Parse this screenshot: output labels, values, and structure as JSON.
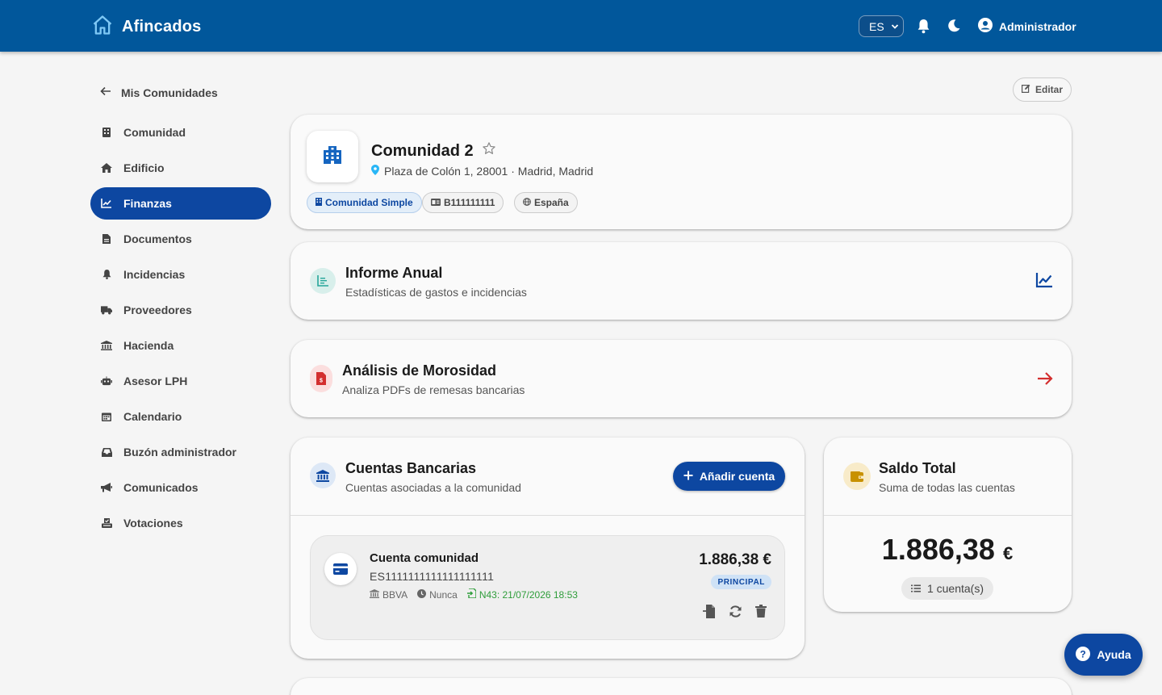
{
  "header": {
    "brand": "Afincados",
    "language": "ES",
    "user_name": "Administrador"
  },
  "sidebar": {
    "back_label": "Mis Comunidades",
    "items": [
      {
        "label": "Comunidad",
        "icon": "building-icon"
      },
      {
        "label": "Edificio",
        "icon": "home-icon"
      },
      {
        "label": "Finanzas",
        "icon": "chart-line-icon",
        "active": true
      },
      {
        "label": "Documentos",
        "icon": "document-icon"
      },
      {
        "label": "Incidencias",
        "icon": "bell-icon"
      },
      {
        "label": "Proveedores",
        "icon": "truck-icon"
      },
      {
        "label": "Hacienda",
        "icon": "bank-icon"
      },
      {
        "label": "Asesor LPH",
        "icon": "robot-icon"
      },
      {
        "label": "Calendario",
        "icon": "calendar-icon"
      },
      {
        "label": "Buzón administrador",
        "icon": "inbox-icon"
      },
      {
        "label": "Comunicados",
        "icon": "megaphone-icon"
      },
      {
        "label": "Votaciones",
        "icon": "ballot-icon"
      }
    ]
  },
  "toolbar": {
    "edit_label": "Editar"
  },
  "community": {
    "name": "Comunidad 2",
    "address": "Plaza de Colón 1, 28001 · Madrid, Madrid",
    "chips": {
      "type": "Comunidad Simple",
      "cif": "B111111111",
      "country": "España"
    }
  },
  "annual_report": {
    "title": "Informe Anual",
    "subtitle": "Estadísticas de gastos e incidencias"
  },
  "delinquency": {
    "title": "Análisis de Morosidad",
    "subtitle": "Analiza PDFs de remesas bancarias"
  },
  "bank_accounts": {
    "title": "Cuentas Bancarias",
    "subtitle": "Cuentas asociadas a la comunidad",
    "add_label": "Añadir cuenta",
    "account": {
      "name": "Cuenta comunidad",
      "iban": "ES1111111111111111111",
      "bank": "BBVA",
      "last_sync": "Nunca",
      "n43": "N43: 21/07/2026 18:53",
      "amount": "1.886,38 €",
      "badge": "PRINCIPAL"
    }
  },
  "total_balance": {
    "title": "Saldo Total",
    "subtitle": "Suma de todas las cuentas",
    "amount": "1.886,38",
    "currency": "€",
    "count": "1 cuenta(s)"
  },
  "help": {
    "label": "Ayuda"
  },
  "colors": {
    "primary": "#01579b",
    "accent": "#0d47a1",
    "danger": "#d32f2f",
    "teal": "#26a69a",
    "amber": "#c89100",
    "success": "#2e9d3a"
  }
}
